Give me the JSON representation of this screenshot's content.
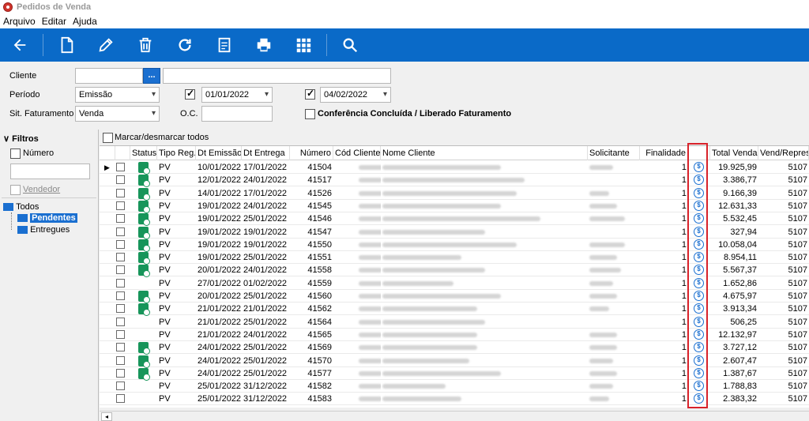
{
  "window": {
    "title": "Pedidos de Venda"
  },
  "menu": [
    "Arquivo",
    "Editar",
    "Ajuda"
  ],
  "toolbar": {
    "icons": [
      "back-arrow-icon",
      "new-document-icon",
      "edit-pencil-icon",
      "trash-icon",
      "refresh-icon",
      "report-icon",
      "print-icon",
      "grid-icon",
      "search-icon"
    ],
    "color": "#0a6ac8"
  },
  "filters": {
    "cliente_label": "Cliente",
    "cliente_value": "",
    "cliente_btn": "...",
    "periodo_label": "Período",
    "periodo_value": "Emissão",
    "date_from_checked": true,
    "date_from": "01/01/2022",
    "date_to_checked": true,
    "date_to": "04/02/2022",
    "sit_label": "Sit. Faturamento",
    "sit_value": "Venda",
    "oc_label": "O.C.",
    "oc_value": "",
    "conferencia_label": "Conferência Concluída / Liberado Faturamento",
    "conferencia_checked": false
  },
  "sidebar": {
    "filtros_label": "Filtros",
    "numero_label": "Número",
    "numero_value": "",
    "vendedor_label": "Vendedor",
    "tree": {
      "root": "Todos",
      "children": [
        "Pendentes",
        "Entregues"
      ],
      "selected": "Pendentes"
    }
  },
  "grid": {
    "select_all_label": "Marcar/desmarcar todos",
    "columns": [
      "Status",
      "Tipo Reg.",
      "Dt Emissão",
      "Dt Entrega",
      "Número",
      "Cód Cliente",
      "Nome Cliente",
      "Solicitante",
      "Finalidade",
      "",
      "Total Venda",
      "Vend/Repres"
    ],
    "rows": [
      {
        "status": true,
        "tipo": "PV",
        "emissao": "10/01/2022",
        "entrega": "17/01/2022",
        "numero": "41504",
        "finalidade": "1",
        "total": "19.925,99",
        "vend": "5107"
      },
      {
        "status": true,
        "tipo": "PV",
        "emissao": "12/01/2022",
        "entrega": "24/01/2022",
        "numero": "41517",
        "finalidade": "1",
        "total": "3.386,77",
        "vend": "5107"
      },
      {
        "status": true,
        "tipo": "PV",
        "emissao": "14/01/2022",
        "entrega": "17/01/2022",
        "numero": "41526",
        "finalidade": "1",
        "total": "9.166,39",
        "vend": "5107"
      },
      {
        "status": true,
        "tipo": "PV",
        "emissao": "19/01/2022",
        "entrega": "24/01/2022",
        "numero": "41545",
        "finalidade": "1",
        "total": "12.631,33",
        "vend": "5107"
      },
      {
        "status": true,
        "tipo": "PV",
        "emissao": "19/01/2022",
        "entrega": "25/01/2022",
        "numero": "41546",
        "finalidade": "1",
        "total": "5.532,45",
        "vend": "5107"
      },
      {
        "status": true,
        "tipo": "PV",
        "emissao": "19/01/2022",
        "entrega": "19/01/2022",
        "numero": "41547",
        "finalidade": "1",
        "total": "327,94",
        "vend": "5107"
      },
      {
        "status": true,
        "tipo": "PV",
        "emissao": "19/01/2022",
        "entrega": "19/01/2022",
        "numero": "41550",
        "finalidade": "1",
        "total": "10.058,04",
        "vend": "5107"
      },
      {
        "status": true,
        "tipo": "PV",
        "emissao": "19/01/2022",
        "entrega": "25/01/2022",
        "numero": "41551",
        "finalidade": "1",
        "total": "8.954,11",
        "vend": "5107"
      },
      {
        "status": true,
        "tipo": "PV",
        "emissao": "20/01/2022",
        "entrega": "24/01/2022",
        "numero": "41558",
        "finalidade": "1",
        "total": "5.567,37",
        "vend": "5107"
      },
      {
        "status": false,
        "tipo": "PV",
        "emissao": "27/01/2022",
        "entrega": "01/02/2022",
        "numero": "41559",
        "finalidade": "1",
        "total": "1.652,86",
        "vend": "5107"
      },
      {
        "status": true,
        "tipo": "PV",
        "emissao": "20/01/2022",
        "entrega": "25/01/2022",
        "numero": "41560",
        "finalidade": "1",
        "total": "4.675,97",
        "vend": "5107"
      },
      {
        "status": true,
        "tipo": "PV",
        "emissao": "21/01/2022",
        "entrega": "21/01/2022",
        "numero": "41562",
        "finalidade": "1",
        "total": "3.913,34",
        "vend": "5107"
      },
      {
        "status": false,
        "tipo": "PV",
        "emissao": "21/01/2022",
        "entrega": "25/01/2022",
        "numero": "41564",
        "finalidade": "1",
        "total": "506,25",
        "vend": "5107"
      },
      {
        "status": false,
        "tipo": "PV",
        "emissao": "21/01/2022",
        "entrega": "24/01/2022",
        "numero": "41565",
        "finalidade": "1",
        "total": "12.132,97",
        "vend": "5107"
      },
      {
        "status": true,
        "tipo": "PV",
        "emissao": "24/01/2022",
        "entrega": "25/01/2022",
        "numero": "41569",
        "finalidade": "1",
        "total": "3.727,12",
        "vend": "5107"
      },
      {
        "status": true,
        "tipo": "PV",
        "emissao": "24/01/2022",
        "entrega": "25/01/2022",
        "numero": "41570",
        "finalidade": "1",
        "total": "2.607,47",
        "vend": "5107"
      },
      {
        "status": true,
        "tipo": "PV",
        "emissao": "24/01/2022",
        "entrega": "25/01/2022",
        "numero": "41577",
        "finalidade": "1",
        "total": "1.387,67",
        "vend": "5107"
      },
      {
        "status": false,
        "tipo": "PV",
        "emissao": "25/01/2022",
        "entrega": "31/12/2022",
        "numero": "41582",
        "finalidade": "1",
        "total": "1.788,83",
        "vend": "5107"
      },
      {
        "status": false,
        "tipo": "PV",
        "emissao": "25/01/2022",
        "entrega": "31/12/2022",
        "numero": "41583",
        "finalidade": "1",
        "total": "2.383,32",
        "vend": "5107"
      }
    ],
    "coin_symbol": "$",
    "highlight_color": "#d8222a"
  }
}
